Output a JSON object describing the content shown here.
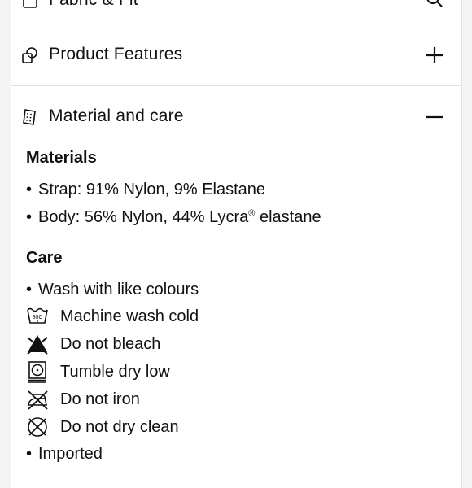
{
  "accordion": {
    "top_item": {
      "label": "Fabric & Fit",
      "icon": "ruler-icon"
    },
    "features": {
      "label": "Product Features",
      "icon": "overlap-shapes-icon",
      "toggle": "plus-icon"
    },
    "material": {
      "label": "Material and care",
      "icon": "fabric-swatch-icon",
      "toggle": "minus-icon"
    }
  },
  "materials": {
    "heading": "Materials",
    "items": [
      {
        "text": "Strap: 91% Nylon, 9% Elastane"
      },
      {
        "text": "Body: 56% Nylon, 44% Lycra",
        "mark": "®",
        "suffix": " elastane"
      }
    ]
  },
  "care": {
    "heading": "Care",
    "items": [
      {
        "text": "Wash with like colours",
        "icon": "bullet"
      },
      {
        "text": "Machine wash cold",
        "icon": "wash-30-icon",
        "icon_label": "30C"
      },
      {
        "text": "Do not bleach",
        "icon": "no-bleach-icon"
      },
      {
        "text": "Tumble dry low",
        "icon": "tumble-dry-low-icon"
      },
      {
        "text": "Do not iron",
        "icon": "no-iron-icon"
      },
      {
        "text": "Do not dry clean",
        "icon": "no-dry-clean-icon"
      },
      {
        "text": "Imported",
        "icon": "bullet"
      }
    ]
  },
  "colors": {
    "text": "#111111",
    "divider": "#e2e2e2",
    "background": "#ffffff"
  }
}
